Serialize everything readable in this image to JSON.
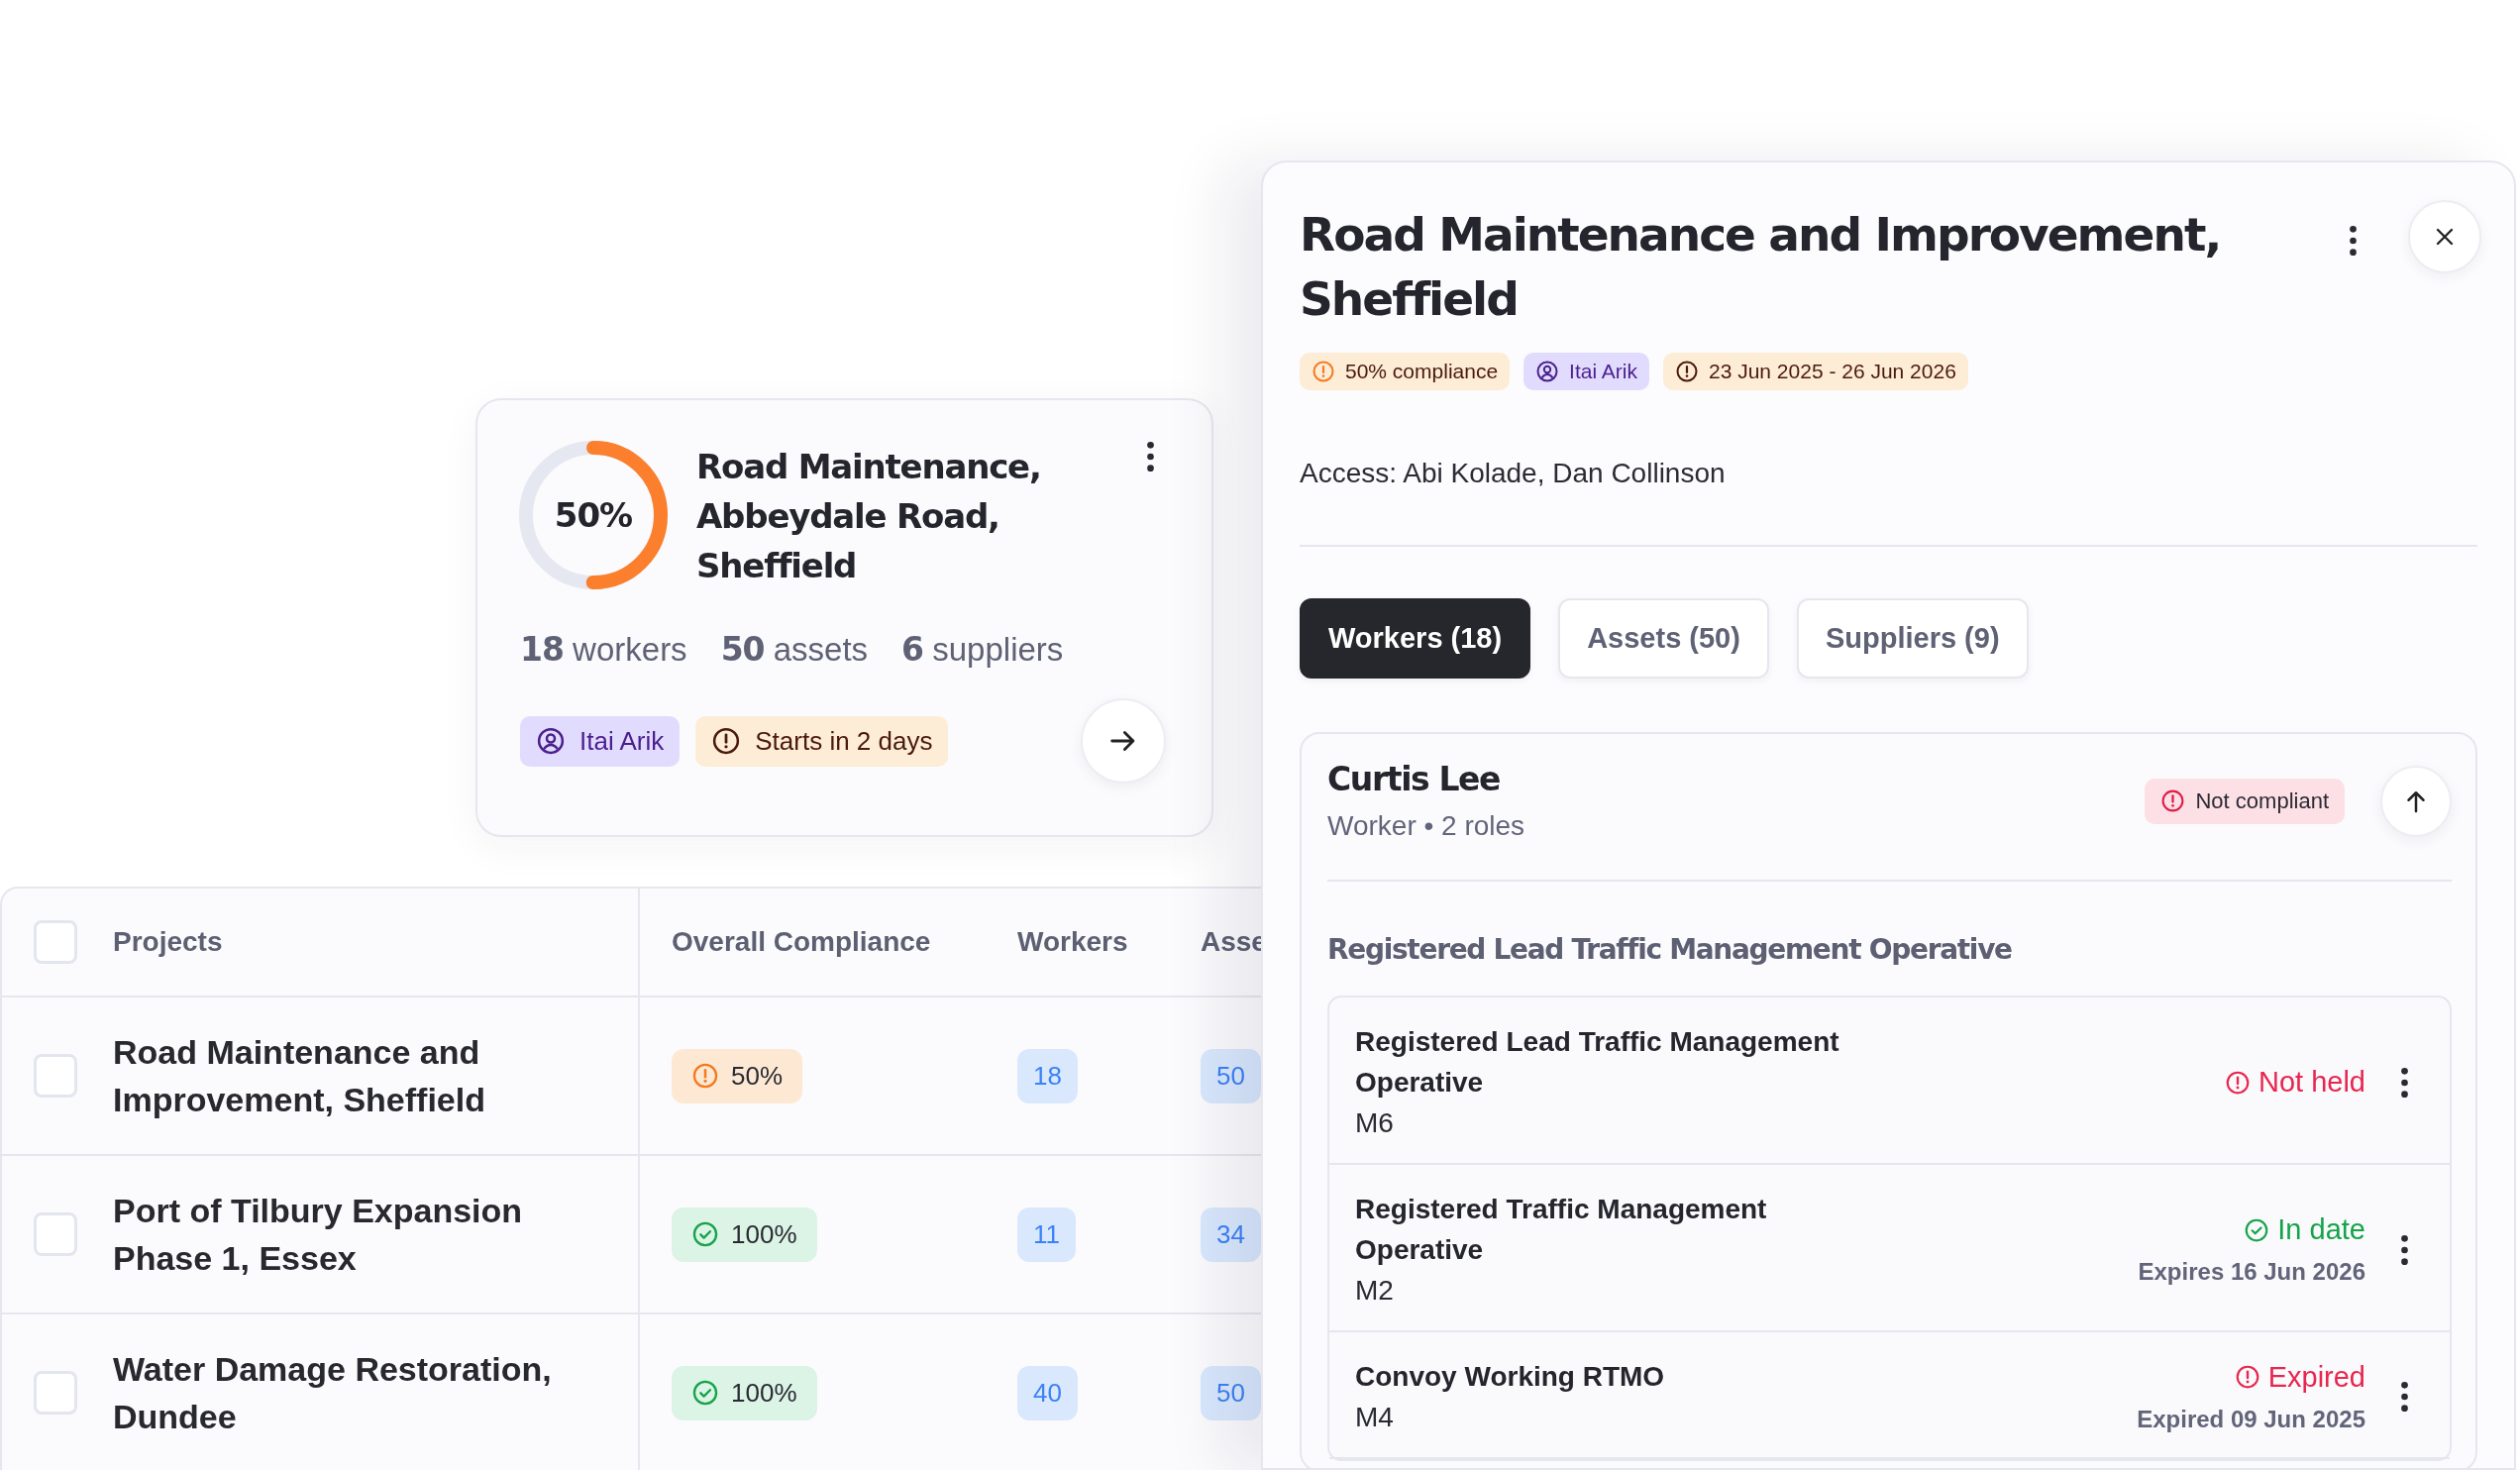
{
  "project_card": {
    "compliance": "50%",
    "level": 0.5,
    "title": "Road Maintenance, Abbeydale Road, Sheffield",
    "stats": [
      {
        "count": "18",
        "label": "workers"
      },
      {
        "count": "50",
        "label": "assets"
      },
      {
        "count": "6",
        "label": "suppliers"
      }
    ],
    "tags": [
      {
        "kind": "person",
        "text": "Itai Arik"
      },
      {
        "kind": "date",
        "text": "Starts in 2 days"
      }
    ]
  },
  "projects_table": {
    "all_checked": false,
    "columns": [
      "Projects",
      "Overall Compliance",
      "Workers",
      "Asse"
    ],
    "rows": [
      {
        "checked": false,
        "project": "Road Maintenance and Improvement, Sheffield",
        "compliance": {
          "kind": "warning",
          "text": "50%"
        },
        "workers": "18",
        "column_4": "50"
      },
      {
        "checked": false,
        "project": "Port of Tilbury Expansion Phase 1, Essex",
        "compliance": {
          "kind": "ok",
          "text": "100%"
        },
        "workers": "11",
        "column_4": "34"
      },
      {
        "checked": false,
        "project": "Water Damage Restoration, Dundee",
        "compliance": {
          "kind": "ok",
          "text": "100%"
        },
        "workers": "40",
        "column_4": "50"
      }
    ]
  },
  "drawer": {
    "title": "Road Maintenance and Improvement, Sheffield",
    "tags": [
      {
        "kind": "warning",
        "text": "50% compliance"
      },
      {
        "kind": "person",
        "text": "Itai Arik"
      },
      {
        "kind": "date",
        "text": "23 Jun 2025 - 26 Jun 2026"
      }
    ],
    "access": "Access: Abi Kolade, Dan Collinson",
    "tabs": [
      {
        "label": "Workers (18)",
        "selected": true
      },
      {
        "label": "Assets (50)",
        "selected": false
      },
      {
        "label": "Suppliers (9)",
        "selected": false
      }
    ],
    "worker": {
      "name": "Curtis Lee",
      "subtitle": "Worker • 2 roles",
      "status": {
        "kind": "error",
        "text": "Not compliant"
      },
      "section": "Registered Lead Traffic Management Operative",
      "credentials": [
        {
          "title": "Registered Lead Traffic Management Operative",
          "code": "M6",
          "status": {
            "kind": "error",
            "text": "Not held"
          }
        },
        {
          "title": "Registered Traffic Management Operative",
          "code": "M2",
          "status": {
            "kind": "ok",
            "text": "In date"
          },
          "note": "Expires 16 Jun 2026"
        },
        {
          "title": "Convoy Working RTMO",
          "code": "M4",
          "status": {
            "kind": "error",
            "text": "Expired"
          },
          "note": "Expired 09 Jun 2025"
        }
      ]
    }
  }
}
